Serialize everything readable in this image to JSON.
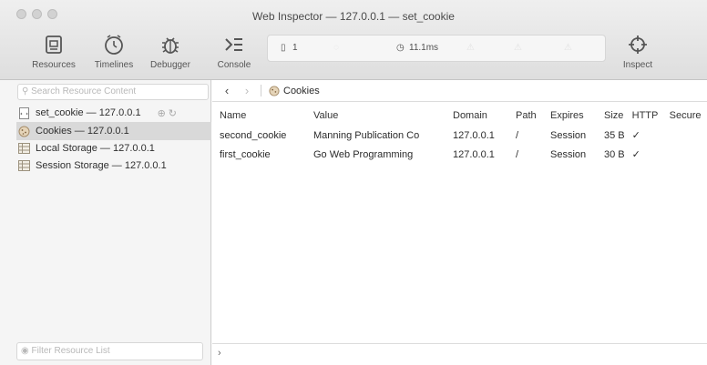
{
  "window": {
    "title": "Web Inspector — 127.0.0.1 — set_cookie"
  },
  "toolbar": {
    "tabs": [
      {
        "label": "Resources",
        "icon": "resources-icon"
      },
      {
        "label": "Timelines",
        "icon": "timelines-icon"
      },
      {
        "label": "Debugger",
        "icon": "debugger-icon"
      },
      {
        "label": "Console",
        "icon": "console-icon"
      }
    ],
    "activity": {
      "documents": "1",
      "load_time": "11.1ms"
    },
    "inspect_label": "Inspect"
  },
  "sidebar": {
    "search_placeholder": "Search Resource Content",
    "resources": [
      {
        "label": "set_cookie — 127.0.0.1",
        "icon": "document-icon"
      },
      {
        "label": "Cookies — 127.0.0.1",
        "icon": "cookie-icon"
      },
      {
        "label": "Local Storage — 127.0.0.1",
        "icon": "storage-icon"
      },
      {
        "label": "Session Storage — 127.0.0.1",
        "icon": "storage-icon"
      }
    ],
    "filter_placeholder": "Filter Resource List"
  },
  "content": {
    "breadcrumb": "Cookies",
    "table": {
      "headers": [
        "Name",
        "Value",
        "Domain",
        "Path",
        "Expires",
        "Size",
        "HTTP",
        "Secure"
      ],
      "rows": [
        [
          "second_cookie",
          "Manning Publication Co",
          "127.0.0.1",
          "/",
          "Session",
          "35 B",
          "✓",
          ""
        ],
        [
          "first_cookie",
          "Go Web Programming",
          "127.0.0.1",
          "/",
          "Session",
          "30 B",
          "✓",
          ""
        ]
      ]
    },
    "bottom_chevron": "›"
  }
}
